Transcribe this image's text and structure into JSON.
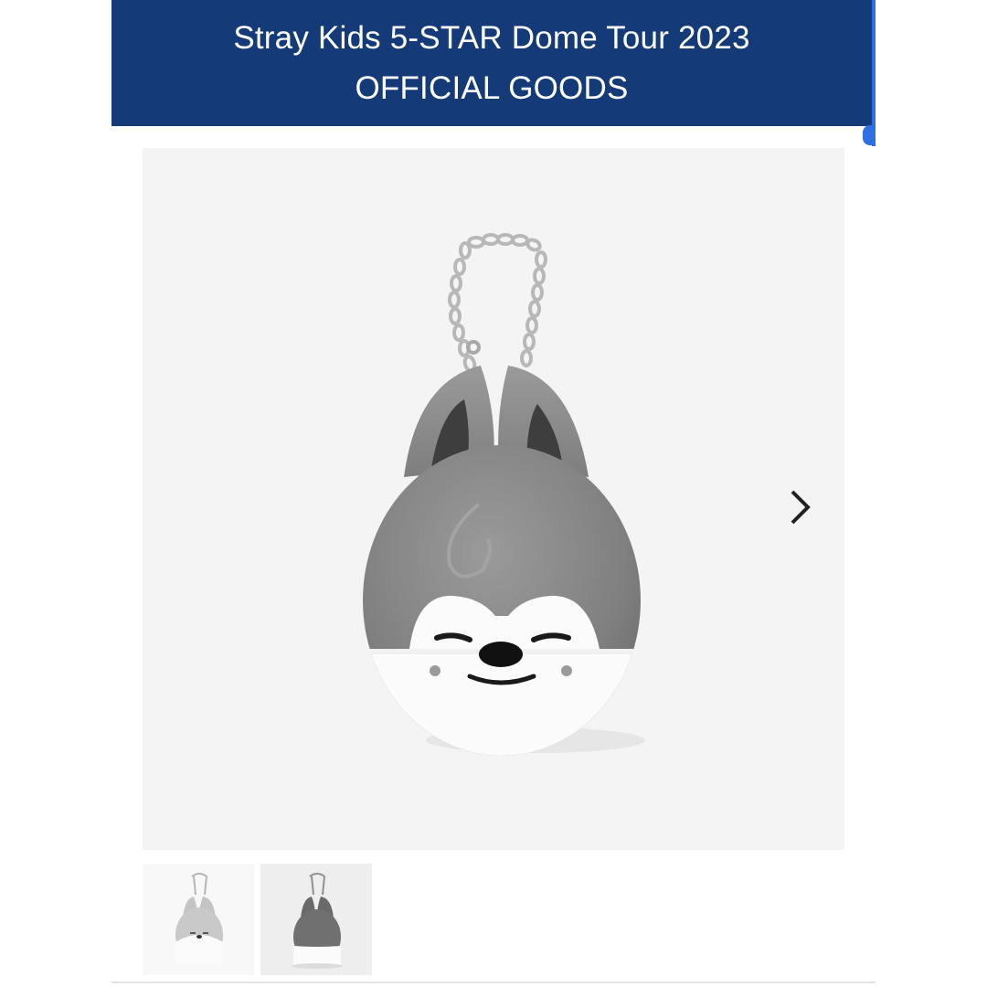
{
  "banner": {
    "line1": "Stray Kids 5-STAR Dome Tour 2023",
    "line2": "OFFICIAL GOODS",
    "background_color": "#143a78",
    "accent_color": "#2d6fe5"
  },
  "gallery": {
    "main_image": "plush-keychain-wolf-front",
    "next_icon": "chevron-right-icon",
    "thumbnails": [
      {
        "image": "plush-keychain-light-thumb"
      },
      {
        "image": "plush-keychain-dark-thumb"
      }
    ]
  }
}
